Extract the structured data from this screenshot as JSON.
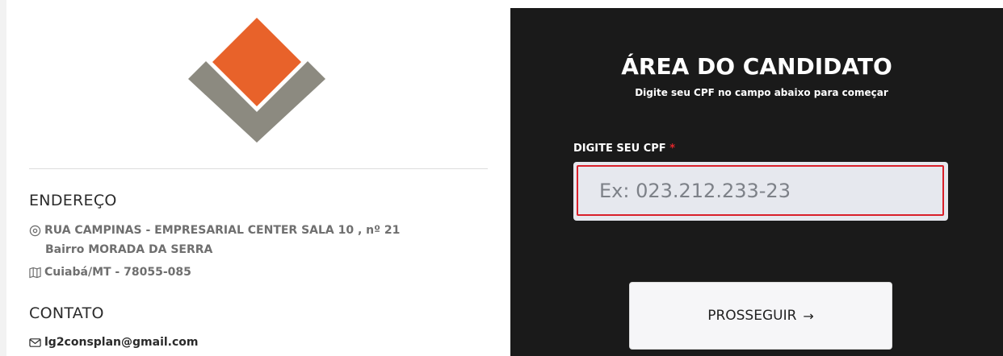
{
  "left": {
    "address_title": "ENDEREÇO",
    "street": "RUA CAMPINAS - EMPRESARIAL CENTER SALA 10 , nº 21",
    "neighborhood": "Bairro MORADA DA SERRA",
    "city": "Cuiabá/MT - 78055-085",
    "contact_title": "CONTATO",
    "email": "lg2consplan@gmail.com"
  },
  "right": {
    "title": "ÁREA DO CANDIDATO",
    "subtitle": "Digite seu CPF no campo abaixo para começar",
    "cpf_label": "DIGITE SEU CPF",
    "required_mark": "*",
    "cpf_placeholder": "Ex: 023.212.233-23",
    "cpf_value": "",
    "proceed_label": "PROSSEGUIR",
    "proceed_arrow": "→"
  },
  "icons": {
    "street": "location-pin-icon",
    "city": "map-icon",
    "email": "envelope-icon"
  },
  "colors": {
    "logo_orange": "#e8622a",
    "logo_gray": "#8c8a80",
    "panel_dark": "#1a1a1a",
    "required_red": "#e0262b"
  }
}
